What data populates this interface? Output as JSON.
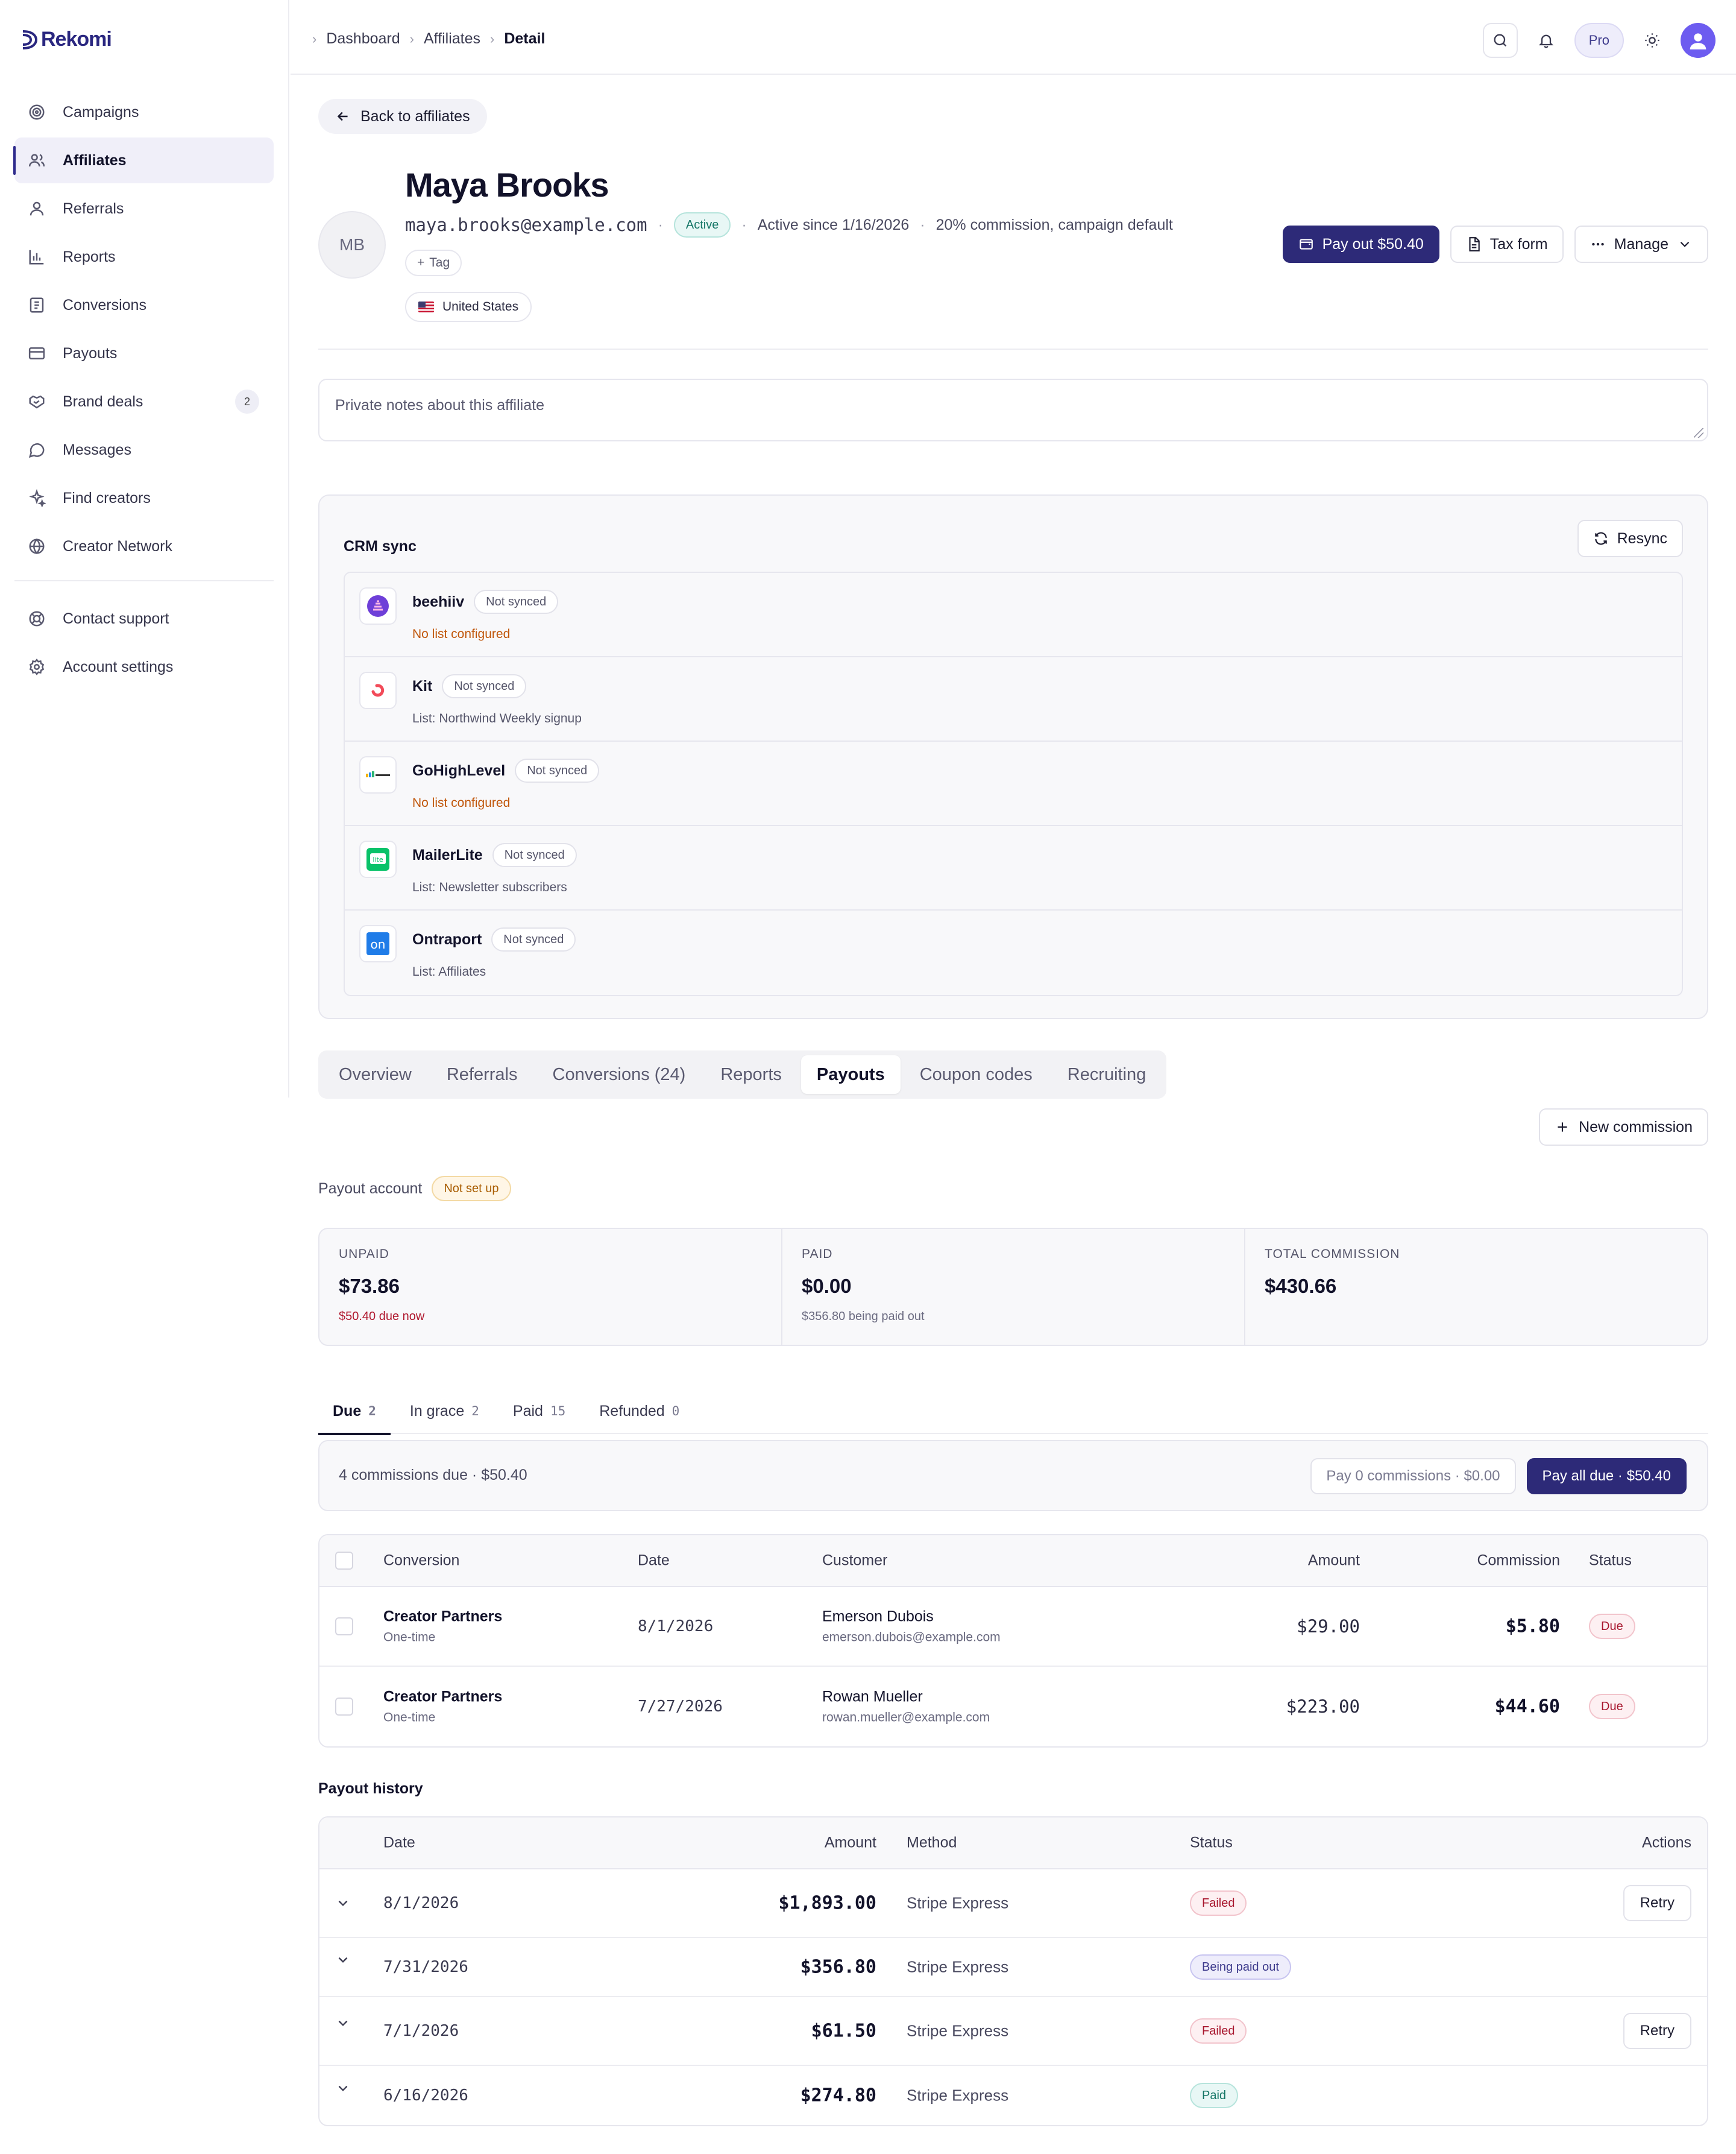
{
  "brand": {
    "name": "Rekomi"
  },
  "sidebar": {
    "items": [
      {
        "label": "Campaigns",
        "icon": "target-icon"
      },
      {
        "label": "Affiliates",
        "icon": "users-icon",
        "active": true
      },
      {
        "label": "Referrals",
        "icon": "user-icon"
      },
      {
        "label": "Reports",
        "icon": "bar-chart-icon"
      },
      {
        "label": "Conversions",
        "icon": "receipt-icon"
      },
      {
        "label": "Payouts",
        "icon": "card-icon"
      },
      {
        "label": "Brand deals",
        "icon": "handshake-icon",
        "badge": "2"
      },
      {
        "label": "Messages",
        "icon": "message-icon"
      },
      {
        "label": "Find creators",
        "icon": "sparkles-icon"
      },
      {
        "label": "Creator Network",
        "icon": "globe-icon"
      }
    ],
    "footer": [
      {
        "label": "Contact support",
        "icon": "lifebuoy-icon"
      },
      {
        "label": "Account settings",
        "icon": "gear-icon"
      }
    ]
  },
  "topbar": {
    "breadcrumb": [
      "Dashboard",
      "Affiliates",
      "Detail"
    ],
    "plan": "Pro"
  },
  "back_label": "Back to affiliates",
  "profile": {
    "initials": "MB",
    "name": "Maya Brooks",
    "email": "maya.brooks@example.com",
    "status": "Active",
    "since": "Active since 1/16/2026",
    "commission": "20% commission, campaign default",
    "tag_label": "Tag",
    "country": "United States"
  },
  "actions": {
    "pay_out": "Pay out $50.40",
    "tax_form": "Tax form",
    "manage": "Manage"
  },
  "notes_placeholder": "Private notes about this affiliate",
  "crm": {
    "title": "CRM sync",
    "resync": "Resync",
    "rows": [
      {
        "name": "beehiiv",
        "status": "Not synced",
        "detail": "No list configured",
        "warn": true
      },
      {
        "name": "Kit",
        "status": "Not synced",
        "detail": "List: Northwind Weekly signup",
        "warn": false
      },
      {
        "name": "GoHighLevel",
        "status": "Not synced",
        "detail": "No list configured",
        "warn": true
      },
      {
        "name": "MailerLite",
        "status": "Not synced",
        "detail": "List: Newsletter subscribers",
        "warn": false
      },
      {
        "name": "Ontraport",
        "status": "Not synced",
        "detail": "List: Affiliates",
        "warn": false
      }
    ]
  },
  "tabs": [
    "Overview",
    "Referrals",
    "Conversions (24)",
    "Reports",
    "Payouts",
    "Coupon codes",
    "Recruiting"
  ],
  "active_tab": "Payouts",
  "new_commission": "New commission",
  "payout_account": {
    "label": "Payout account",
    "status": "Not set up"
  },
  "stats": [
    {
      "label": "UNPAID",
      "value": "$73.86",
      "sub": "$50.40 due now"
    },
    {
      "label": "PAID",
      "value": "$0.00",
      "sub": "$356.80 being paid out"
    },
    {
      "label": "TOTAL COMMISSION",
      "value": "$430.66",
      "sub": ""
    }
  ],
  "subtabs": [
    {
      "label": "Due",
      "count": "2"
    },
    {
      "label": "In grace",
      "count": "2"
    },
    {
      "label": "Paid",
      "count": "15"
    },
    {
      "label": "Refunded",
      "count": "0"
    }
  ],
  "due_bar": {
    "summary": "4 commissions due · $50.40",
    "pay_selected": "Pay 0 commissions · $0.00",
    "pay_all": "Pay all due · $50.40"
  },
  "commissions": {
    "headers": [
      "Conversion",
      "Date",
      "Customer",
      "Amount",
      "Commission",
      "Status"
    ],
    "rows": [
      {
        "conversion": "Creator Partners",
        "type": "One-time",
        "date": "8/1/2026",
        "customer": "Emerson Dubois",
        "email": "emerson.dubois@example.com",
        "amount": "$29.00",
        "commission": "$5.80",
        "status": "Due"
      },
      {
        "conversion": "Creator Partners",
        "type": "One-time",
        "date": "7/27/2026",
        "customer": "Rowan Mueller",
        "email": "rowan.mueller@example.com",
        "amount": "$223.00",
        "commission": "$44.60",
        "status": "Due"
      }
    ]
  },
  "payout_history": {
    "title": "Payout history",
    "headers": [
      "Date",
      "Amount",
      "Method",
      "Status",
      "Actions"
    ],
    "rows": [
      {
        "date": "8/1/2026",
        "amount": "$1,893.00",
        "method": "Stripe Express",
        "status": "Failed",
        "action": "Retry"
      },
      {
        "date": "7/31/2026",
        "amount": "$356.80",
        "method": "Stripe Express",
        "status": "Being paid out",
        "action": ""
      },
      {
        "date": "7/1/2026",
        "amount": "$61.50",
        "method": "Stripe Express",
        "status": "Failed",
        "action": "Retry"
      },
      {
        "date": "6/16/2026",
        "amount": "$274.80",
        "method": "Stripe Express",
        "status": "Paid",
        "action": ""
      }
    ]
  }
}
